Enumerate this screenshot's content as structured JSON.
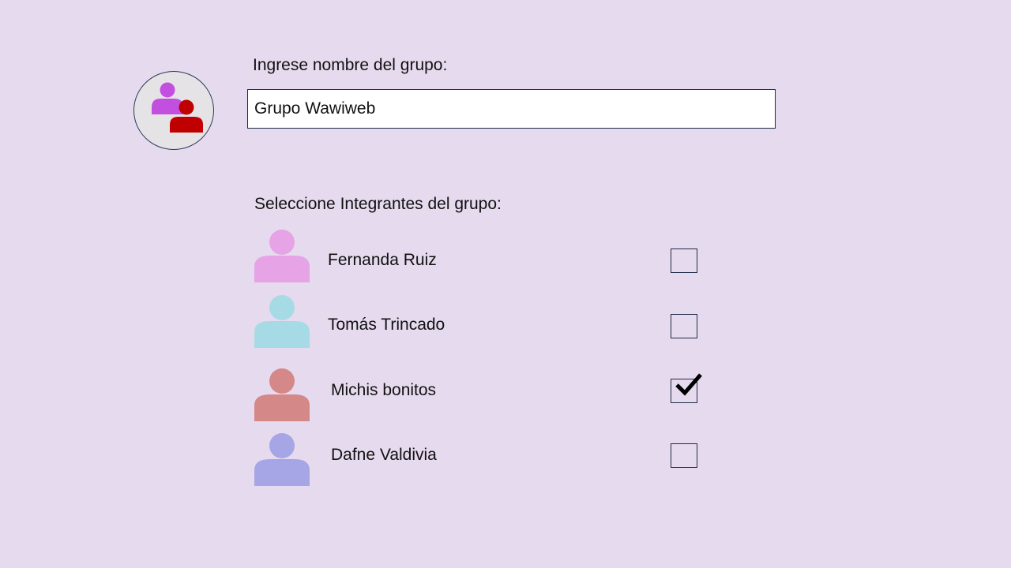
{
  "group": {
    "name_label": "Ingrese nombre del grupo:",
    "name_value": "Grupo Wawiweb",
    "avatar_icon": "group-people-icon",
    "avatar_colors": [
      "#c24fe0",
      "#c00000"
    ]
  },
  "members_label": "Seleccione Integrantes del grupo:",
  "members": [
    {
      "name": "Fernanda Ruiz",
      "color": "#e6a3e6",
      "selected": false
    },
    {
      "name": "Tomás Trincado",
      "color": "#a6dbe6",
      "selected": false
    },
    {
      "name": "Michis bonitos",
      "color": "#d48888",
      "selected": true
    },
    {
      "name": "Dafne Valdivia",
      "color": "#a6a6e6",
      "selected": false
    }
  ]
}
